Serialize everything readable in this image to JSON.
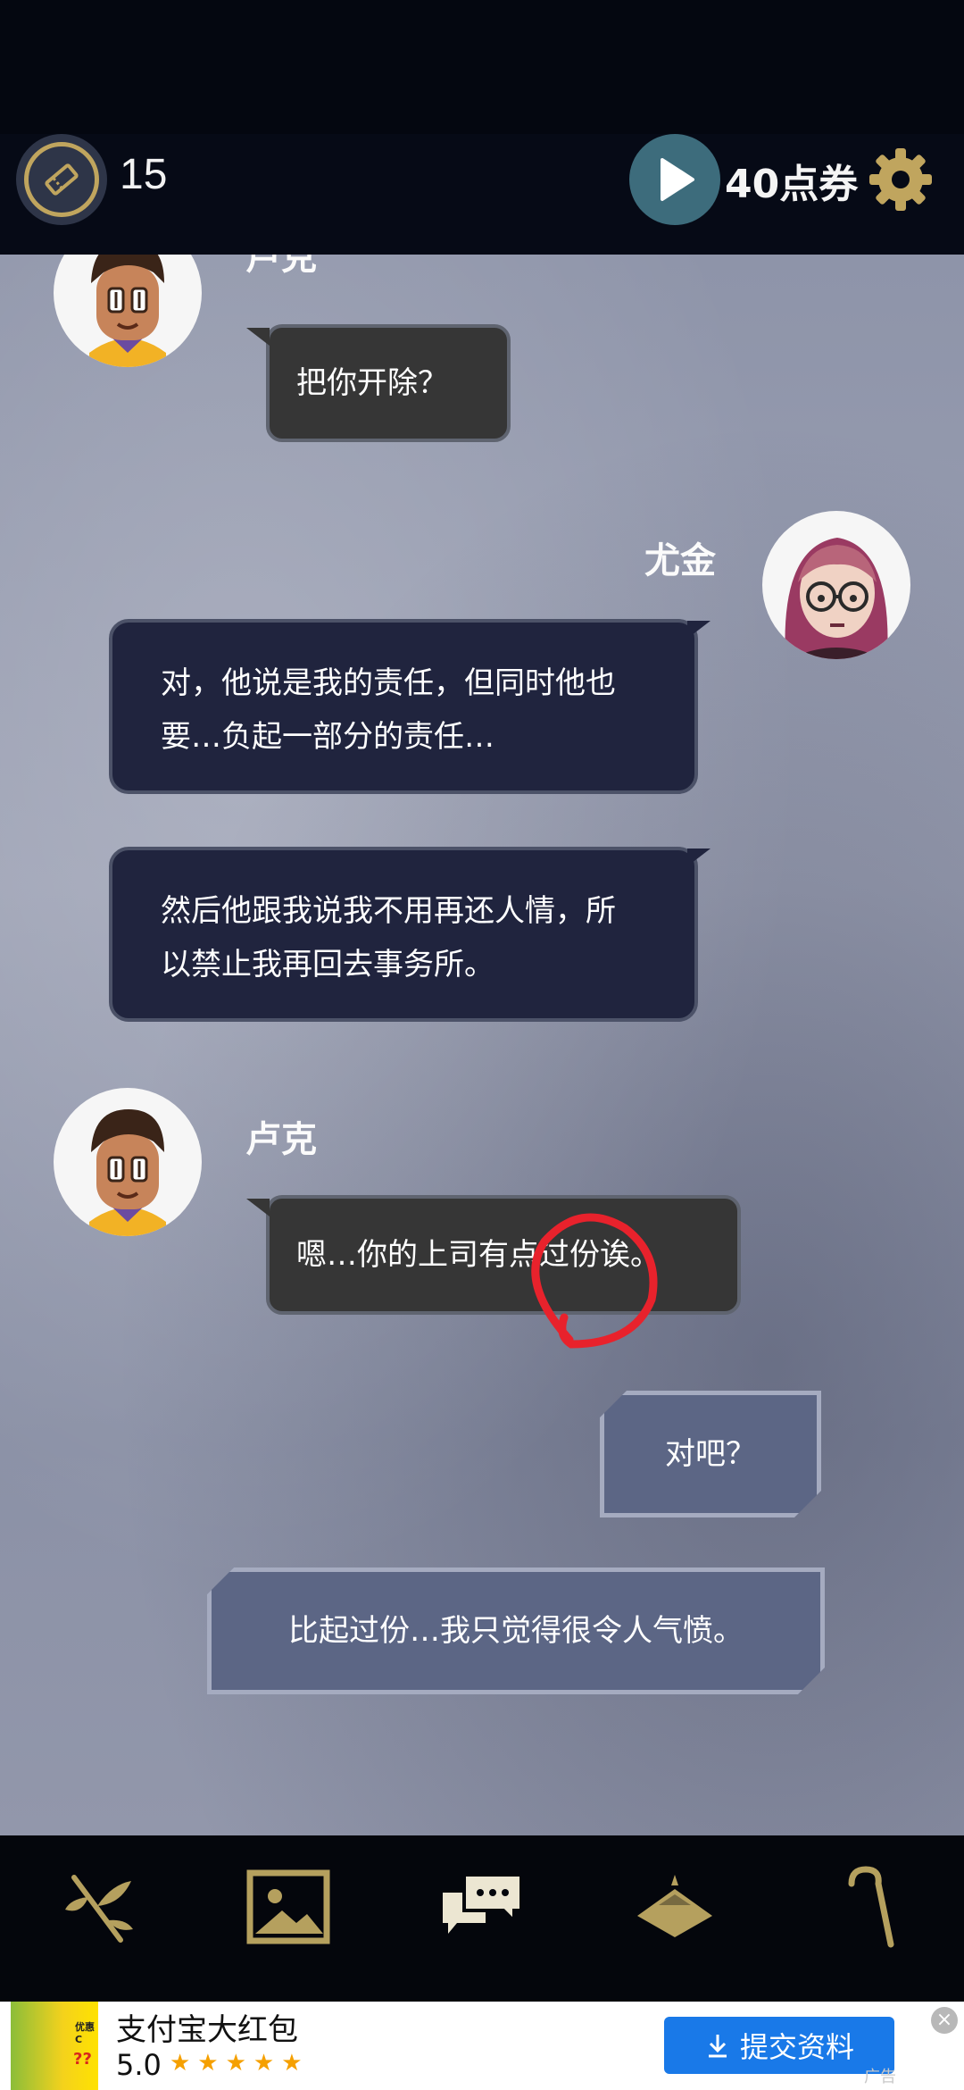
{
  "header": {
    "ticket_count": "15",
    "voucher_label": "40点券"
  },
  "icons": {
    "ticket": "ticket-icon",
    "play": "play-icon",
    "settings": "gear-icon",
    "accent_color": "#c0a55e"
  },
  "chat": {
    "messages": [
      {
        "speaker": "卢克",
        "text": "把你开除？"
      },
      {
        "speaker": "尤金",
        "lines": [
          "对，他说是我的责任，但同时他也",
          "要…负起一部分的责任…"
        ]
      },
      {
        "speaker": "尤金",
        "lines": [
          "然后他跟我说我不用再还人情，所",
          "以禁止我再回去事务所。"
        ]
      },
      {
        "speaker": "卢克",
        "text": "嗯…你的上司有点过份诶。"
      },
      {
        "speaker": "player",
        "text": "对吧？"
      },
      {
        "speaker": "player",
        "text": "比起过份…我只觉得很令人气愤。"
      }
    ]
  },
  "nav": {
    "items": [
      "branch-icon",
      "gallery-icon",
      "chat-icon",
      "hat-icon",
      "cane-icon"
    ],
    "active": "chat-icon"
  },
  "ad": {
    "thumb_label": "优惠C",
    "thumb_mark": "??",
    "title": "支付宝大红包",
    "rating": "5.0",
    "stars": "★★★★★",
    "button_label": "提交资料",
    "tag": "广告"
  }
}
